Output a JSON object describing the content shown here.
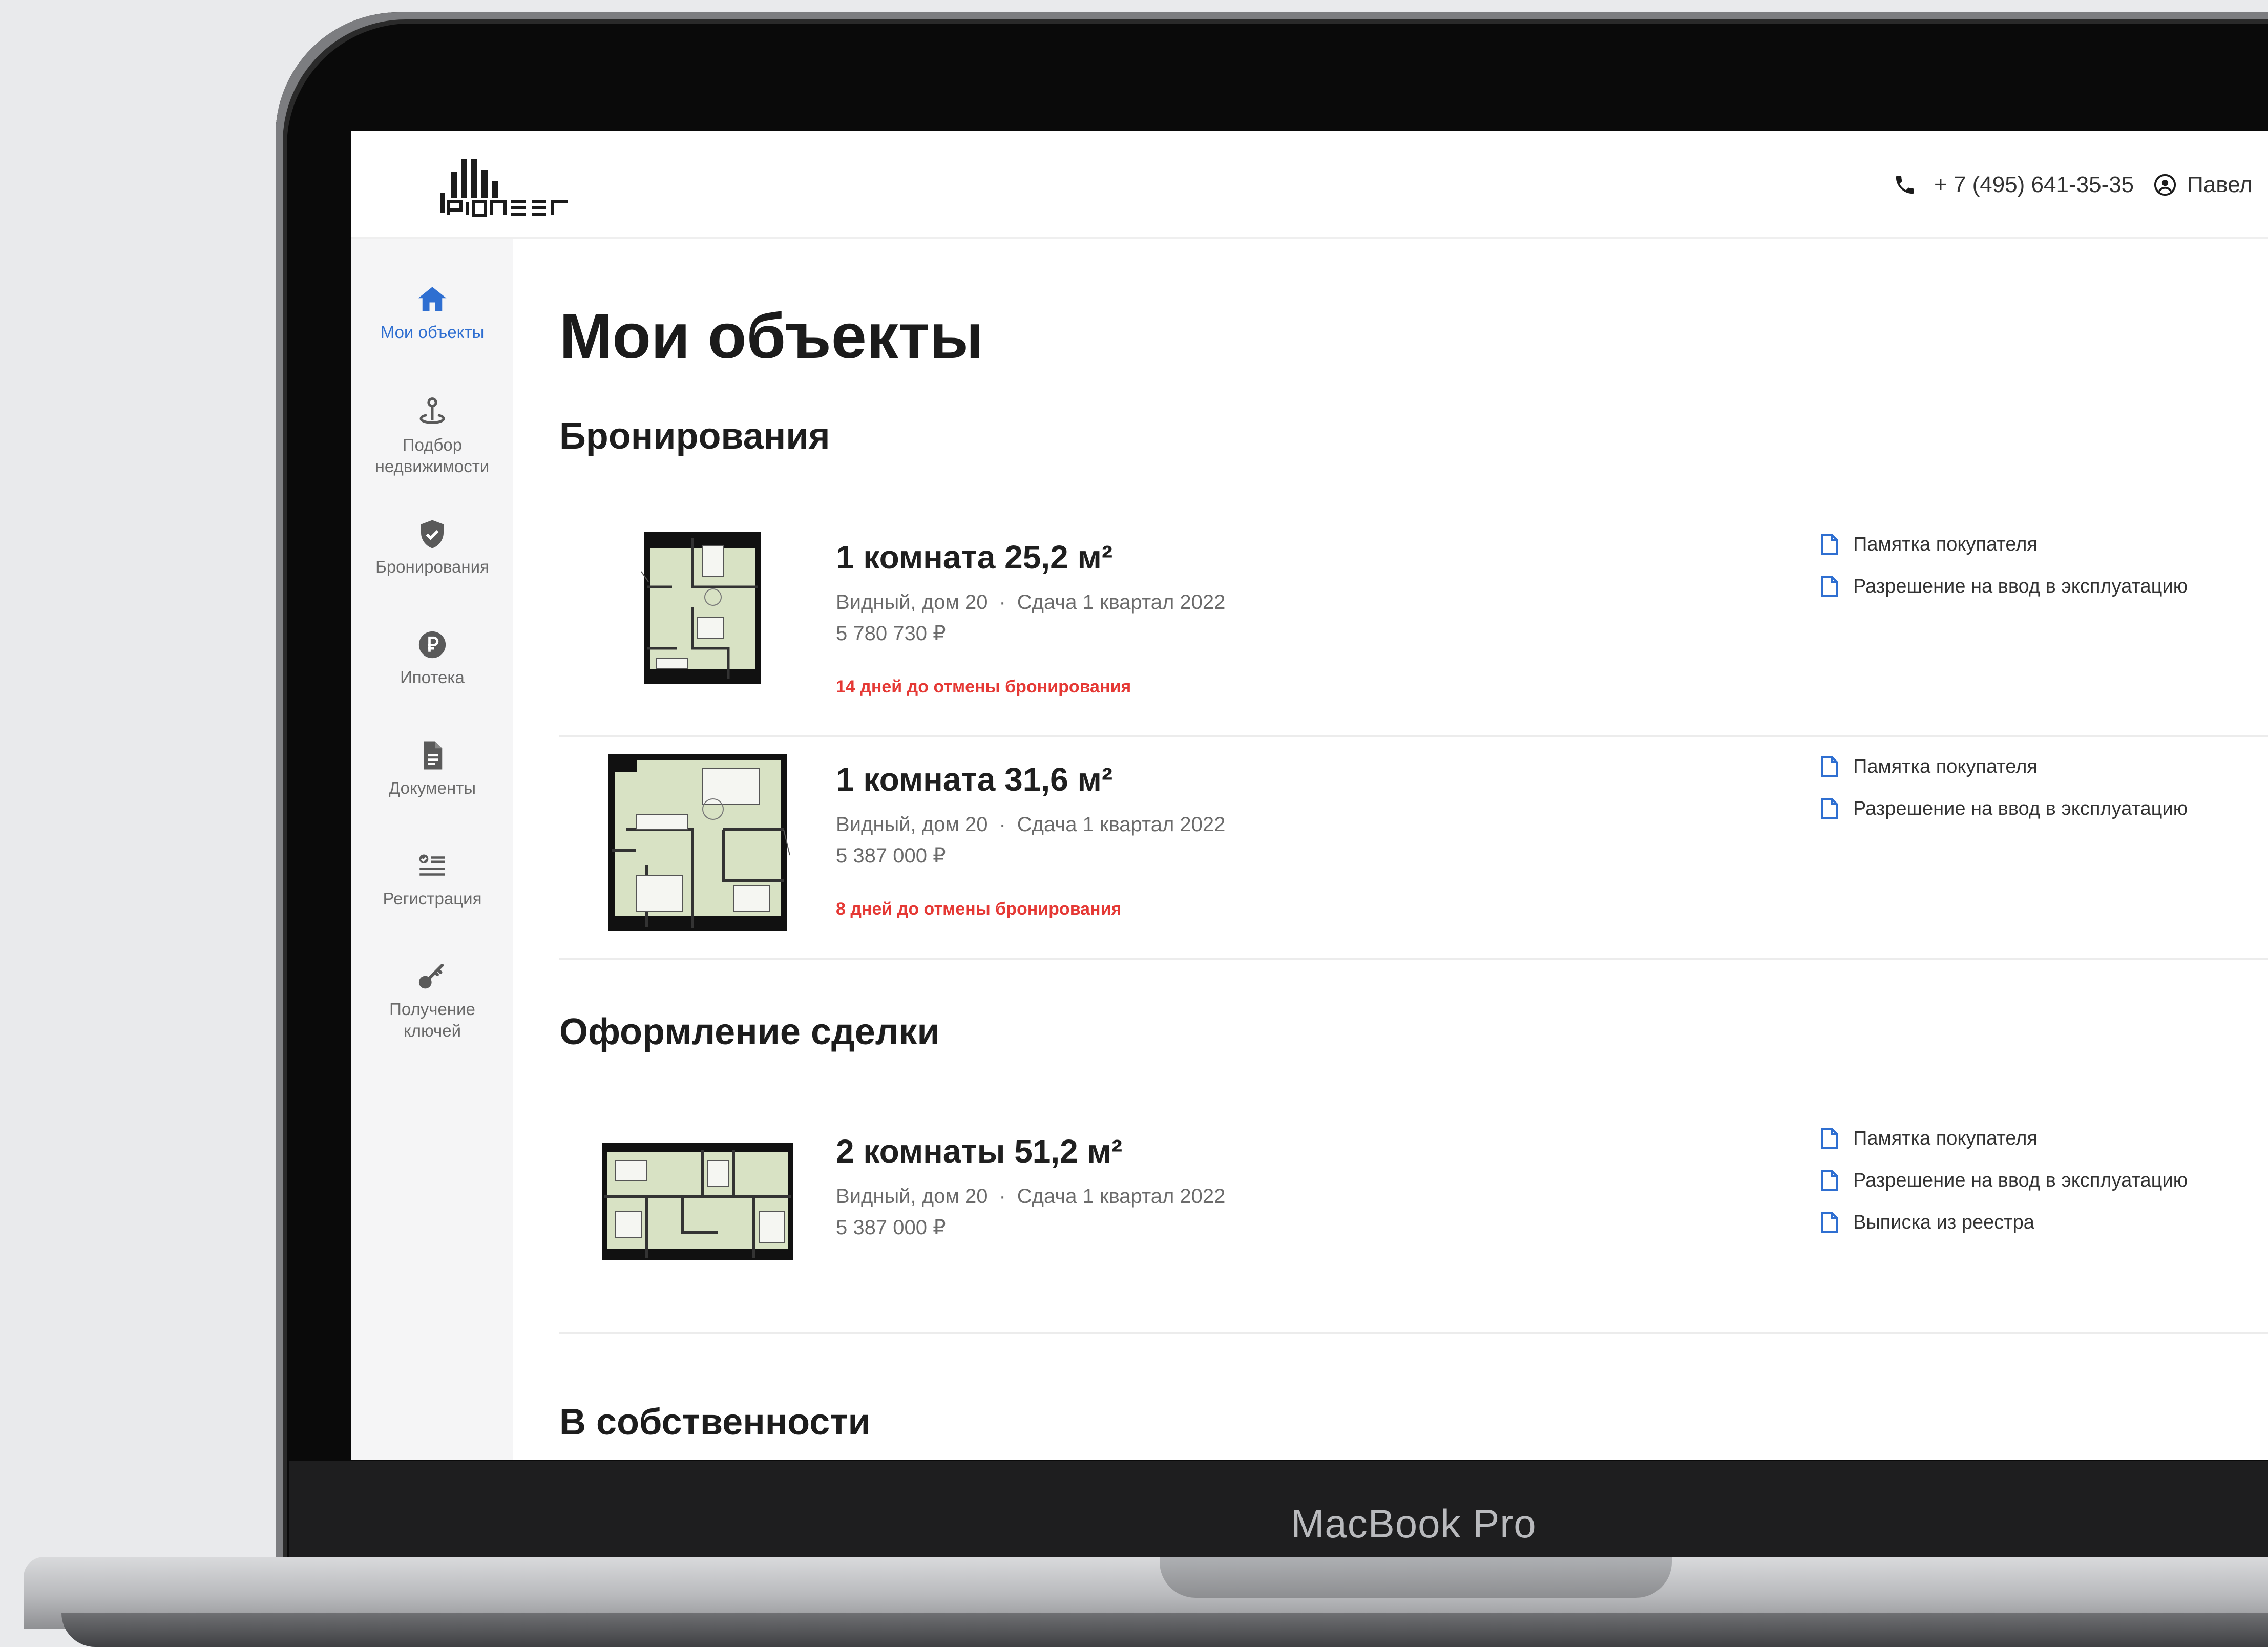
{
  "device": {
    "label": "MacBook Pro"
  },
  "header": {
    "logo_text": "pioneer",
    "phone": "+ 7 (495) 641-35-35",
    "user_name": "Павел"
  },
  "sidebar": {
    "items": [
      {
        "label": "Мои объекты",
        "icon": "home-icon",
        "active": true
      },
      {
        "label": "Подбор недвижимости",
        "icon": "map-pin-icon",
        "active": false
      },
      {
        "label": "Бронирования",
        "icon": "shield-check-icon",
        "active": false
      },
      {
        "label": "Ипотека",
        "icon": "ruble-coin-icon",
        "active": false
      },
      {
        "label": "Документы",
        "icon": "document-icon",
        "active": false
      },
      {
        "label": "Регистрация",
        "icon": "checklist-icon",
        "active": false
      },
      {
        "label": "Получение ключей",
        "icon": "key-icon",
        "active": false
      }
    ]
  },
  "main": {
    "title": "Мои объекты",
    "sections": [
      {
        "title": "Бронирования",
        "items": [
          {
            "title": "1 комната 25,2 м²",
            "location": "Видный, дом 20",
            "handover": "Сдача 1 квартал 2022",
            "price": "5 780 730 ₽",
            "warning": "14 дней до отмены бронирования",
            "docs": [
              "Памятка покупателя",
              "Разрешение на ввод в эксплуатацию"
            ]
          },
          {
            "title": "1 комната 31,6 м²",
            "location": "Видный, дом 20",
            "handover": "Сдача 1 квартал 2022",
            "price": "5 387 000 ₽",
            "warning": "8 дней до отмены бронирования",
            "docs": [
              "Памятка покупателя",
              "Разрешение на ввод в эксплуатацию"
            ]
          }
        ]
      },
      {
        "title": "Оформление сделки",
        "items": [
          {
            "title": "2 комнаты 51,2 м²",
            "location": "Видный, дом 20",
            "handover": "Сдача 1 квартал 2022",
            "price": "5 387 000 ₽",
            "docs": [
              "Памятка покупателя",
              "Разрешение на ввод в эксплуатацию",
              "Выписка из реестра"
            ]
          }
        ]
      },
      {
        "title": "В собственности",
        "items": []
      }
    ],
    "meta_separator": "·"
  },
  "colors": {
    "accent": "#2f6fd1",
    "warning": "#e53935",
    "sidebar_bg": "#f5f5f6",
    "floorplan_fill": "#d8e2c4"
  }
}
